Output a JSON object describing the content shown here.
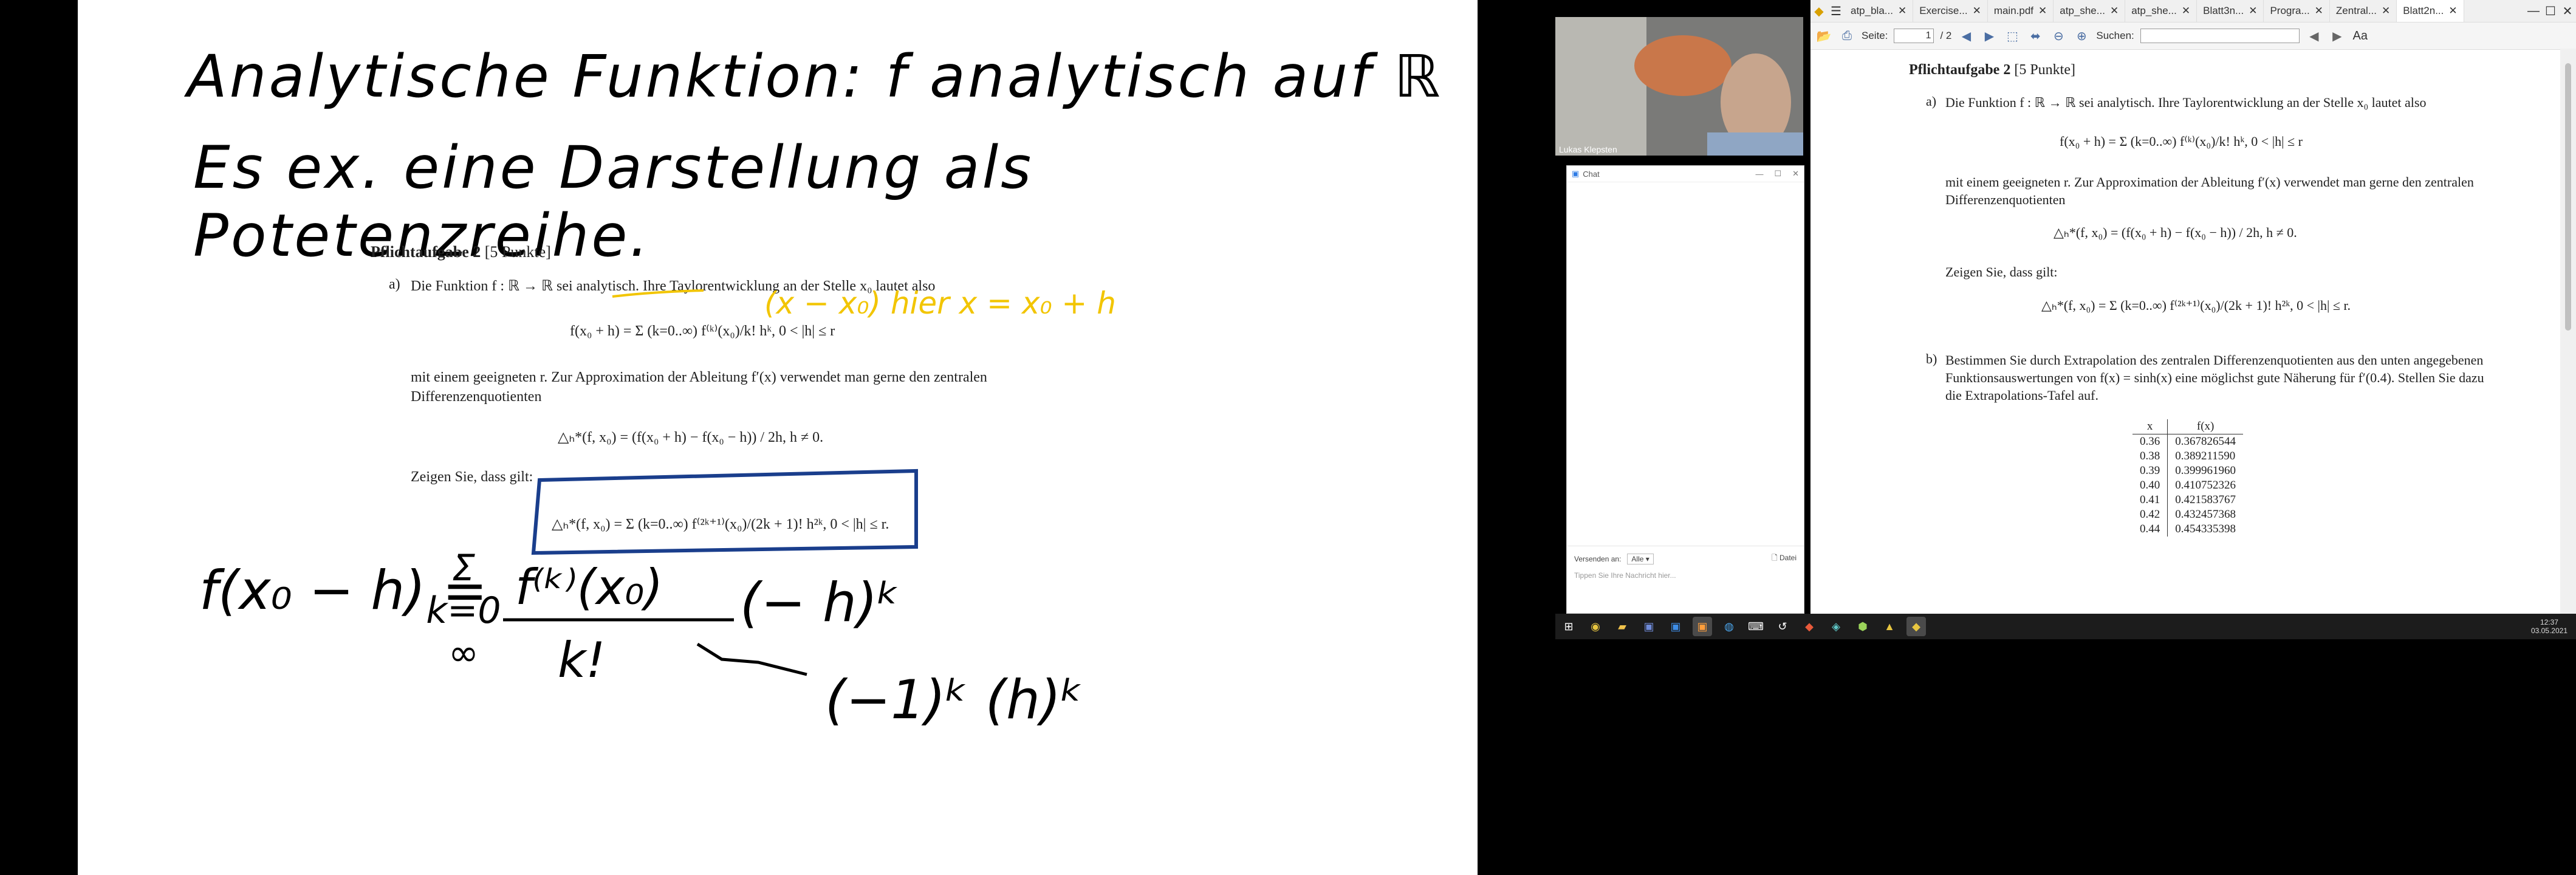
{
  "whiteboard": {
    "handwriting": {
      "line1": "Analytische Funktion: f analytisch auf ℝ",
      "line2": "Es ex. eine Darstellung als Potetenzreihe.",
      "note_yellow": "(x − x₀) hier x = x₀ + h",
      "formula_lhs": "f(x₀ − h) =",
      "formula_sum": "Σ k=0 ∞",
      "formula_num": "f⁽ᵏ⁾(x₀)",
      "formula_den": "k!",
      "formula_pow": "(− h)ᵏ",
      "formula_expand": "(−1)ᵏ (h)ᵏ"
    },
    "task": {
      "heading": "Pflichtaufgabe 2",
      "points": "[5 Punkte]",
      "a_label": "a)",
      "a_text1": "Die Funktion f : ℝ → ℝ sei analytisch. Ihre Taylorentwicklung an der Stelle x₀ lautet also",
      "a_formula1": "f(x₀ + h) = Σ (k=0..∞) f⁽ᵏ⁾(x₀)/k! hᵏ,   0 < |h| ≤ r",
      "a_text2": "mit einem geeigneten r. Zur Approximation der Ableitung f′(x) verwendet man gerne den zentralen Differenzenquotienten",
      "a_formula2": "△ₕ*(f, x₀) = (f(x₀ + h) − f(x₀ − h)) / 2h,   h ≠ 0.",
      "a_text3": "Zeigen Sie, dass gilt:",
      "a_formula3": "△ₕ*(f, x₀) = Σ (k=0..∞) f⁽²ᵏ⁺¹⁾(x₀)/(2k + 1)! h²ᵏ,   0 < |h| ≤ r."
    }
  },
  "webcam": {
    "name": "Lukas Klepsten"
  },
  "chat": {
    "title": "Chat",
    "send_to_label": "Versenden an:",
    "send_to_value": "Alle",
    "file_button": "Datei",
    "input_placeholder": "Tippen Sie Ihre Nachricht hier..."
  },
  "viewer": {
    "tabs": [
      {
        "label": "atp_bla..."
      },
      {
        "label": "Exercise..."
      },
      {
        "label": "main.pdf"
      },
      {
        "label": "atp_she..."
      },
      {
        "label": "atp_she..."
      },
      {
        "label": "Blatt3n..."
      },
      {
        "label": "Progra..."
      },
      {
        "label": "Zentral..."
      },
      {
        "label": "Blatt2n..."
      }
    ],
    "page_label": "Seite:",
    "page_value": "1",
    "page_total": "/ 2",
    "search_label": "Suchen:",
    "doc": {
      "heading": "Pflichtaufgabe 2",
      "points": "[5 Punkte]",
      "a_label": "a)",
      "a_text1": "Die Funktion f : ℝ → ℝ sei analytisch. Ihre Taylorentwicklung an der Stelle x₀ lautet also",
      "a_formula1": "f(x₀ + h) = Σ (k=0..∞) f⁽ᵏ⁾(x₀)/k! hᵏ,   0 < |h| ≤ r",
      "a_text2": "mit einem geeigneten r. Zur Approximation der Ableitung f′(x) verwendet man gerne den zentralen Differenzenquotienten",
      "a_formula2": "△ₕ*(f, x₀) = (f(x₀ + h) − f(x₀ − h)) / 2h,   h ≠ 0.",
      "a_text3": "Zeigen Sie, dass gilt:",
      "a_formula3": "△ₕ*(f, x₀) = Σ (k=0..∞) f⁽²ᵏ⁺¹⁾(x₀)/(2k + 1)! h²ᵏ,   0 < |h| ≤ r.",
      "b_label": "b)",
      "b_text": "Bestimmen Sie durch Extrapolation des zentralen Differenzenquotienten aus den unten angegebenen Funktionsauswertungen von f(x) = sinh(x) eine möglichst gute Näherung für f′(0.4). Stellen Sie dazu die Extrapolations-Tafel auf.",
      "table_header": [
        "x",
        "f(x)"
      ],
      "table_rows": [
        [
          "0.36",
          "0.367826544"
        ],
        [
          "0.38",
          "0.389211590"
        ],
        [
          "0.39",
          "0.399961960"
        ],
        [
          "0.40",
          "0.410752326"
        ],
        [
          "0.41",
          "0.421583767"
        ],
        [
          "0.42",
          "0.432457368"
        ],
        [
          "0.44",
          "0.454335398"
        ]
      ]
    }
  },
  "taskbar": {
    "time": "12:37",
    "date": "03.05.2021"
  },
  "colors": {
    "pen_black": "#000000",
    "pen_yellow": "#f2c500",
    "pen_blue": "#1a3e8c",
    "viewer_icon_blue": "#4b6ea3"
  }
}
